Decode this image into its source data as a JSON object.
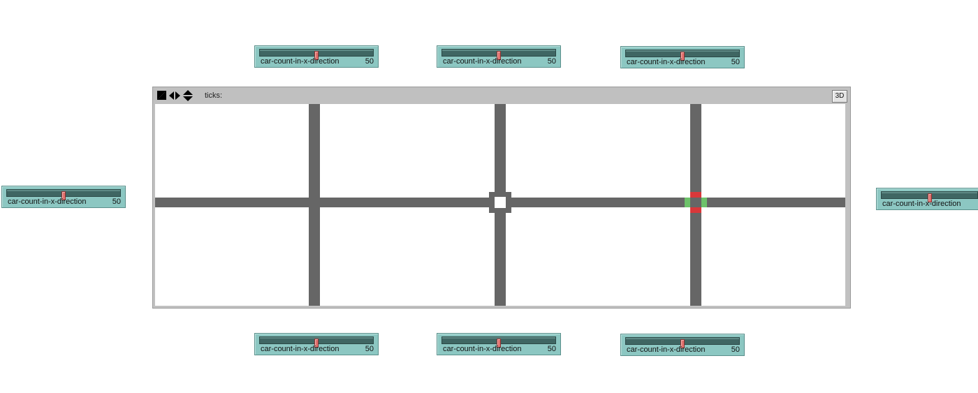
{
  "sliders": [
    {
      "name": "car-count-in-x-direction",
      "value": "50",
      "fraction": 0.5
    },
    {
      "name": "car-count-in-x-direction",
      "value": "50",
      "fraction": 0.5
    },
    {
      "name": "car-count-in-x-direction",
      "value": "50",
      "fraction": 0.5
    },
    {
      "name": "car-count-in-x-direction",
      "value": "50",
      "fraction": 0.5
    },
    {
      "name": "car-count-in-x-direction",
      "value": "50",
      "fraction": 0.5
    },
    {
      "name": "car-count-in-x-direction",
      "value": "50",
      "fraction": 0.5
    },
    {
      "name": "car-count-in-x-direction",
      "value": "50",
      "fraction": 0.5
    },
    {
      "name": "car-count-in-x-direction",
      "value": "50",
      "fraction": 0.5
    }
  ],
  "view": {
    "ticks_label": "ticks:",
    "three_d_label": "3D"
  },
  "colors": {
    "road": "#666666",
    "signal_red": "#d9383a",
    "signal_green": "#6dc26a",
    "slider_bg": "#8cc7c2"
  },
  "icons": {
    "edit": "pencil-square-icon",
    "horizontal": "left-right-arrows-icon",
    "vertical": "up-down-arrows-icon"
  }
}
